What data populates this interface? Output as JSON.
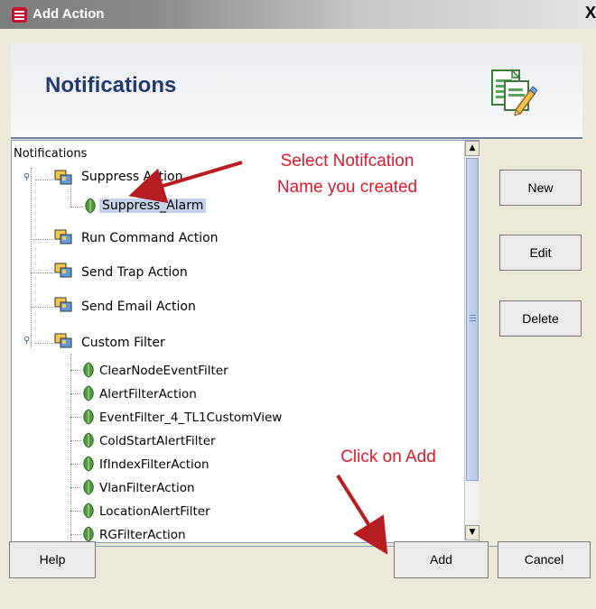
{
  "window": {
    "title": "Add Action",
    "close_symbol": "X"
  },
  "header": {
    "title": "Notifications"
  },
  "tree": {
    "root_label": "Notifications",
    "groups": [
      {
        "label": "Suppress Action",
        "expanded": true,
        "children": [
          "Suppress_Alarm"
        ],
        "selected_child": "Suppress_Alarm"
      },
      {
        "label": "Run Command Action"
      },
      {
        "label": "Send Trap Action"
      },
      {
        "label": "Send Email Action"
      },
      {
        "label": "Custom Filter",
        "expanded": true,
        "children": [
          "ClearNodeEventFilter",
          "AlertFilterAction",
          "EventFilter_4_TL1CustomView",
          "ColdStartAlertFilter",
          "IfIndexFilterAction",
          "VlanFilterAction",
          "LocationAlertFilter",
          "RGFilterAction"
        ]
      }
    ]
  },
  "side_buttons": {
    "new": "New",
    "edit": "Edit",
    "delete": "Delete"
  },
  "footer_buttons": {
    "help": "Help",
    "add": "Add",
    "cancel": "Cancel"
  },
  "annotations": {
    "select_line1": "Select Notifcation",
    "select_line2": "Name you created",
    "click_add": "Click on Add"
  },
  "colors": {
    "annotation": "#d81b2c",
    "header_title": "#233a6f",
    "selection": "#c5d2e9"
  }
}
